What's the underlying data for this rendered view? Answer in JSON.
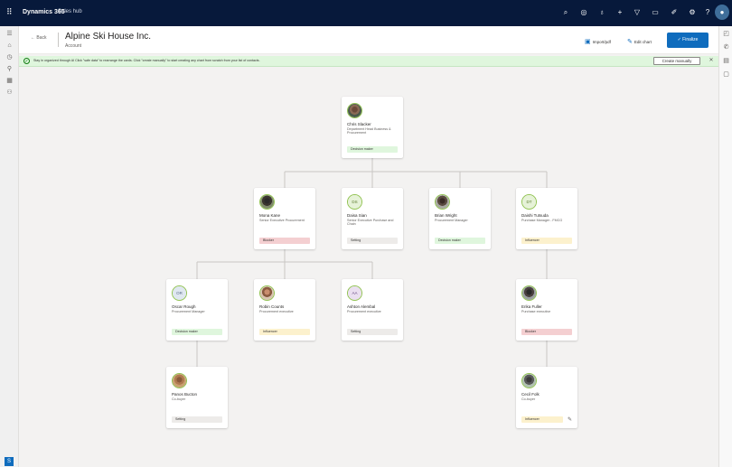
{
  "app": {
    "brand": "Dynamics 365",
    "name": "Sales hub"
  },
  "topbar_icons": [
    "search-icon",
    "assistant-icon",
    "lightbulb-icon",
    "add-icon",
    "filter-icon",
    "chat-icon",
    "help-icon",
    "settings-icon",
    "question-icon"
  ],
  "header": {
    "back_label": "← Back",
    "title": "Alpine Ski House Inc.",
    "subtitle": "Account",
    "import_label": "Import/pdf",
    "edit_chart_label": "Edit chart",
    "finalize_label": "✓ Finalize"
  },
  "infobar": {
    "text": "Stay in organized through AI Click \"safe data\" to rearrange the cards. Click \"create manually\" to start creating any chart from scratch from your list of contacts.",
    "create_manually_label": "Create manually",
    "close_glyph": "✕"
  },
  "tag_colors": {
    "green": "#dff6dd",
    "red": "#f4cfd1",
    "yellow": "#fcf1cd",
    "grey": "#edebe9"
  },
  "cards": [
    {
      "name": "Chris Slacker",
      "role": "Department Head Business & Procurement",
      "tag": "Decision maker",
      "tone": "green",
      "avatar": "photo"
    },
    {
      "name": "Mona Kane",
      "role": "Senior Executive Procurement",
      "tag": "Blocker",
      "tone": "red",
      "avatar": "photo"
    },
    {
      "name": "Daisa Sian",
      "role": "Senior Executive Purchase and Chain",
      "tag": "Setting",
      "tone": "grey",
      "avatar": "initials",
      "initials": "DS"
    },
    {
      "name": "Brian Wright",
      "role": "Procurement Manager",
      "tag": "Decision maker",
      "tone": "green",
      "avatar": "photo"
    },
    {
      "name": "Daishi Tutsuda",
      "role": "Purchase Manager - FMCG",
      "tag": "Influencer",
      "tone": "yellow",
      "avatar": "initials",
      "initials": "DT"
    },
    {
      "name": "Oscar Rough",
      "role": "Procurement Manager",
      "tag": "Decision maker",
      "tone": "green",
      "avatar": "initials",
      "initials": "OR"
    },
    {
      "name": "Robin Counts",
      "role": "Procurement executive",
      "tag": "Influencer",
      "tone": "yellow",
      "avatar": "photo"
    },
    {
      "name": "Ashton Alembal",
      "role": "Procurement executive",
      "tag": "Setting",
      "tone": "grey",
      "avatar": "initials",
      "initials": "AA"
    },
    {
      "name": "Erika Fuller",
      "role": "Purchase executive",
      "tag": "Blocker",
      "tone": "red",
      "avatar": "photo"
    },
    {
      "name": "Panos Bucton",
      "role": "Co-buyer",
      "tag": "Setting",
      "tone": "grey",
      "avatar": "photo"
    },
    {
      "name": "Cecil Folk",
      "role": "Co-buyer",
      "tag": "Influencer",
      "tone": "yellow",
      "avatar": "photo"
    }
  ]
}
